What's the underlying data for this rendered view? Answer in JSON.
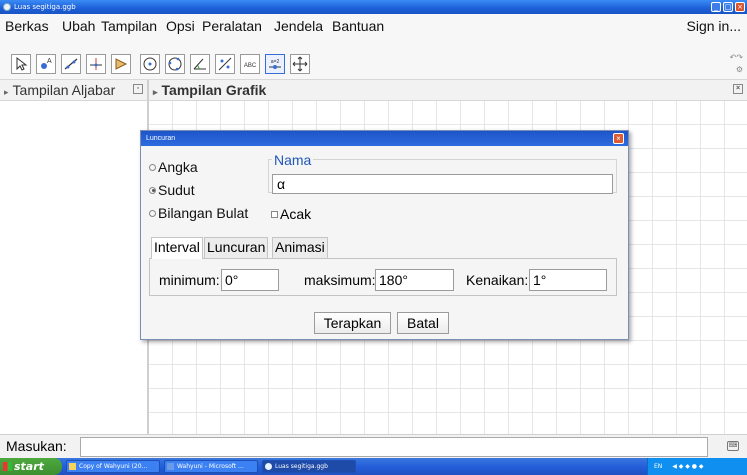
{
  "window": {
    "title": "Luas segitiga.ggb"
  },
  "menu": {
    "items": [
      "Berkas",
      "Ubah",
      "Tampilan",
      "Opsi",
      "Peralatan",
      "Jendela",
      "Bantuan"
    ],
    "signin": "Sign in..."
  },
  "toolbar": {
    "tools": [
      "move-tool",
      "point-tool",
      "line-tool",
      "perpendicular-tool",
      "polygon-tool",
      "circle-tool",
      "circle-three-points-tool",
      "angle-tool",
      "reflect-tool",
      "text-tool",
      "slider-tool",
      "move-view-tool"
    ],
    "text_tool_label": "ABC",
    "slider_tool_label": "a=2"
  },
  "panels": {
    "algebra_title": "Tampilan Aljabar",
    "graphics_title": "Tampilan Grafik"
  },
  "dialog": {
    "title": "Luncuran",
    "type_options": [
      "Angka",
      "Sudut",
      "Bilangan Bulat"
    ],
    "selected_type": "Sudut",
    "name_legend": "Nama",
    "name_value": "α",
    "random_label": "Acak",
    "tabs": [
      "Interval",
      "Luncuran",
      "Animasi"
    ],
    "active_tab": "Interval",
    "min_label": "minimum:",
    "min_value": "0°",
    "max_label": "maksimum:",
    "max_value": "180°",
    "step_label": "Kenaikan:",
    "step_value": "1°",
    "apply_label": "Terapkan",
    "cancel_label": "Batal"
  },
  "input_bar": {
    "label": "Masukan:"
  },
  "taskbar": {
    "start_label": "start",
    "tasks": [
      "Copy of Wahyuni (20...",
      "Wahyuni - Microsoft ...",
      "Luas segitiga.ggb"
    ],
    "tray_lang": "EN"
  },
  "colors": {
    "title_bar": "#245edb",
    "dialog_close": "#de5a32",
    "legend_blue": "#1f56b8",
    "start_green": "#3c8f2f"
  }
}
